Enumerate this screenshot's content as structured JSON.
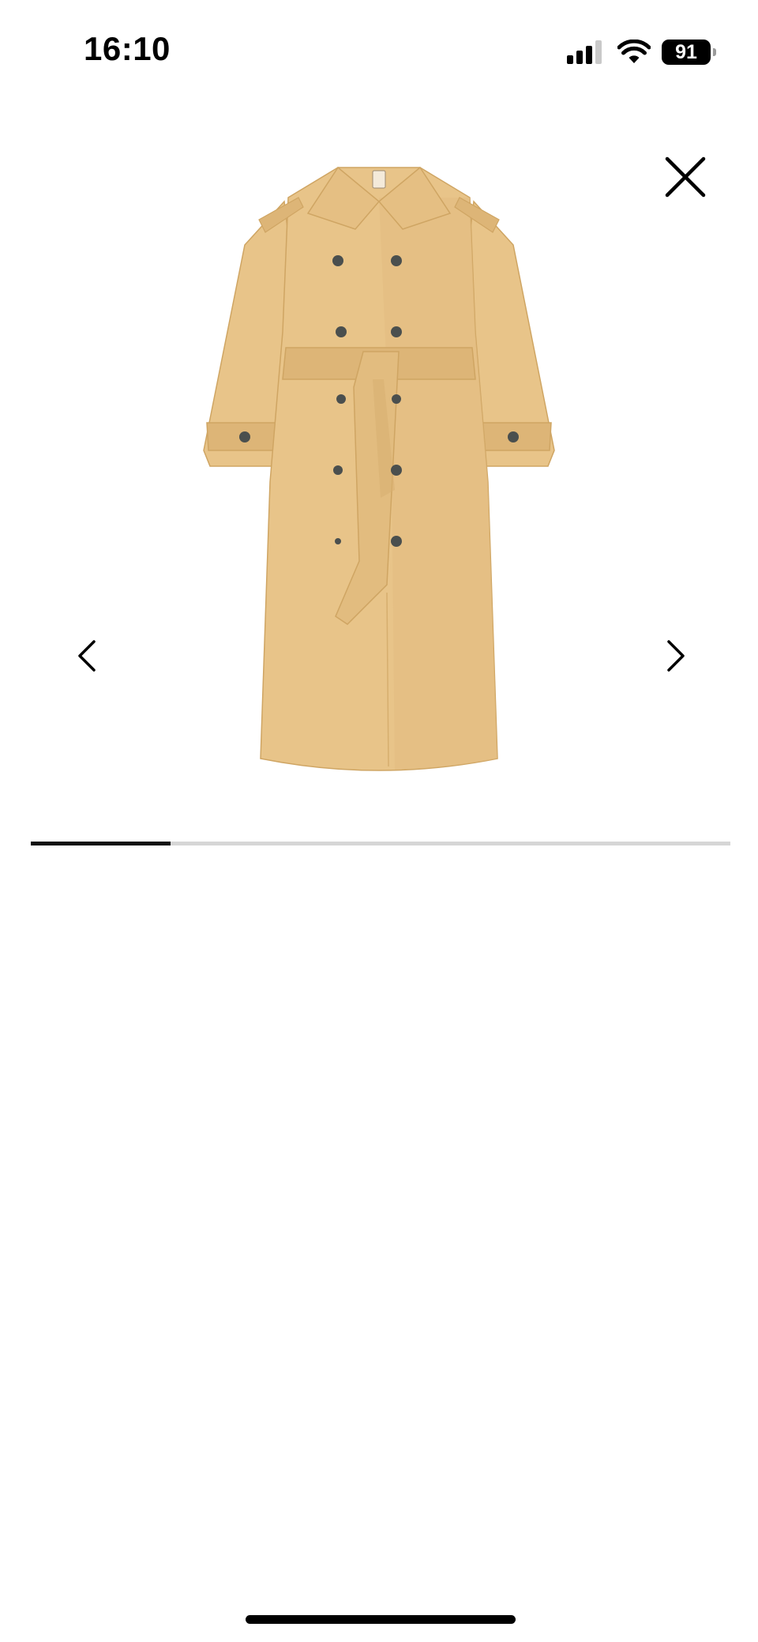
{
  "status_bar": {
    "time": "16:10",
    "battery": "91",
    "icons": [
      "signal-icon",
      "wifi-icon",
      "battery-icon"
    ]
  },
  "viewer": {
    "close_icon": "close-icon",
    "prev_icon": "chevron-left-icon",
    "next_icon": "chevron-right-icon",
    "image": "beige-double-breasted-belted-trench-coat",
    "progress": 0.2
  },
  "colors": {
    "coat": "#E8C489",
    "coat_shadow": "#D6AE6E",
    "buttons": "#4A4F4E",
    "progress_fill": "#111111",
    "progress_track": "#D6D6D6"
  }
}
